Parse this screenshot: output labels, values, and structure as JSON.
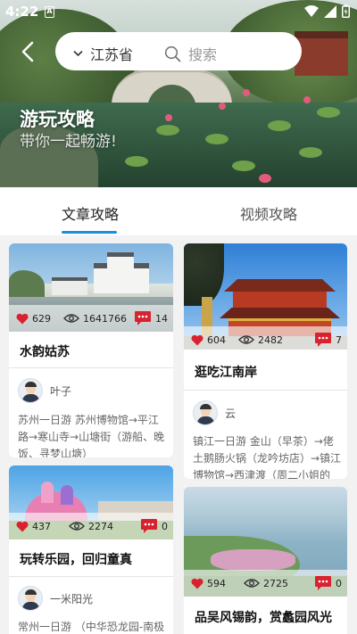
{
  "status": {
    "time": "4:22",
    "sim_label": "A"
  },
  "search": {
    "province": "江苏省",
    "placeholder": "搜索"
  },
  "banner": {
    "title": "游玩攻略",
    "subtitle": "带你一起畅游!"
  },
  "tabs": [
    {
      "label": "文章攻略",
      "active": true
    },
    {
      "label": "视频攻略",
      "active": false
    }
  ],
  "colors": {
    "accent": "#1a8fd8",
    "like": "#d8222f",
    "comment": "#d8222f"
  },
  "cards": [
    {
      "title": "水韵姑苏",
      "likes": "629",
      "views": "1641766",
      "comments": "14",
      "author": "叶子",
      "desc": "苏州一日游 苏州博物馆→平江路→寒山寺→山塘街（游船、晚饭、寻梦山塘）"
    },
    {
      "title": "逛吃江南岸",
      "likes": "604",
      "views": "2482",
      "comments": "7",
      "author": "云",
      "desc": "镇江一日游 金山（早茶）→佬土鹅肠火锅（龙吟坊店）→镇江博物馆→西津渡（周二小姐的菜）"
    },
    {
      "title": "玩转乐园，回归童真",
      "likes": "437",
      "views": "2274",
      "comments": "0",
      "author": "一米阳光",
      "desc": "常州一日游 （中华恐龙园-南极"
    },
    {
      "title": "品吴风锡韵，赏蠡园风光",
      "likes": "594",
      "views": "2725",
      "comments": "0"
    }
  ]
}
